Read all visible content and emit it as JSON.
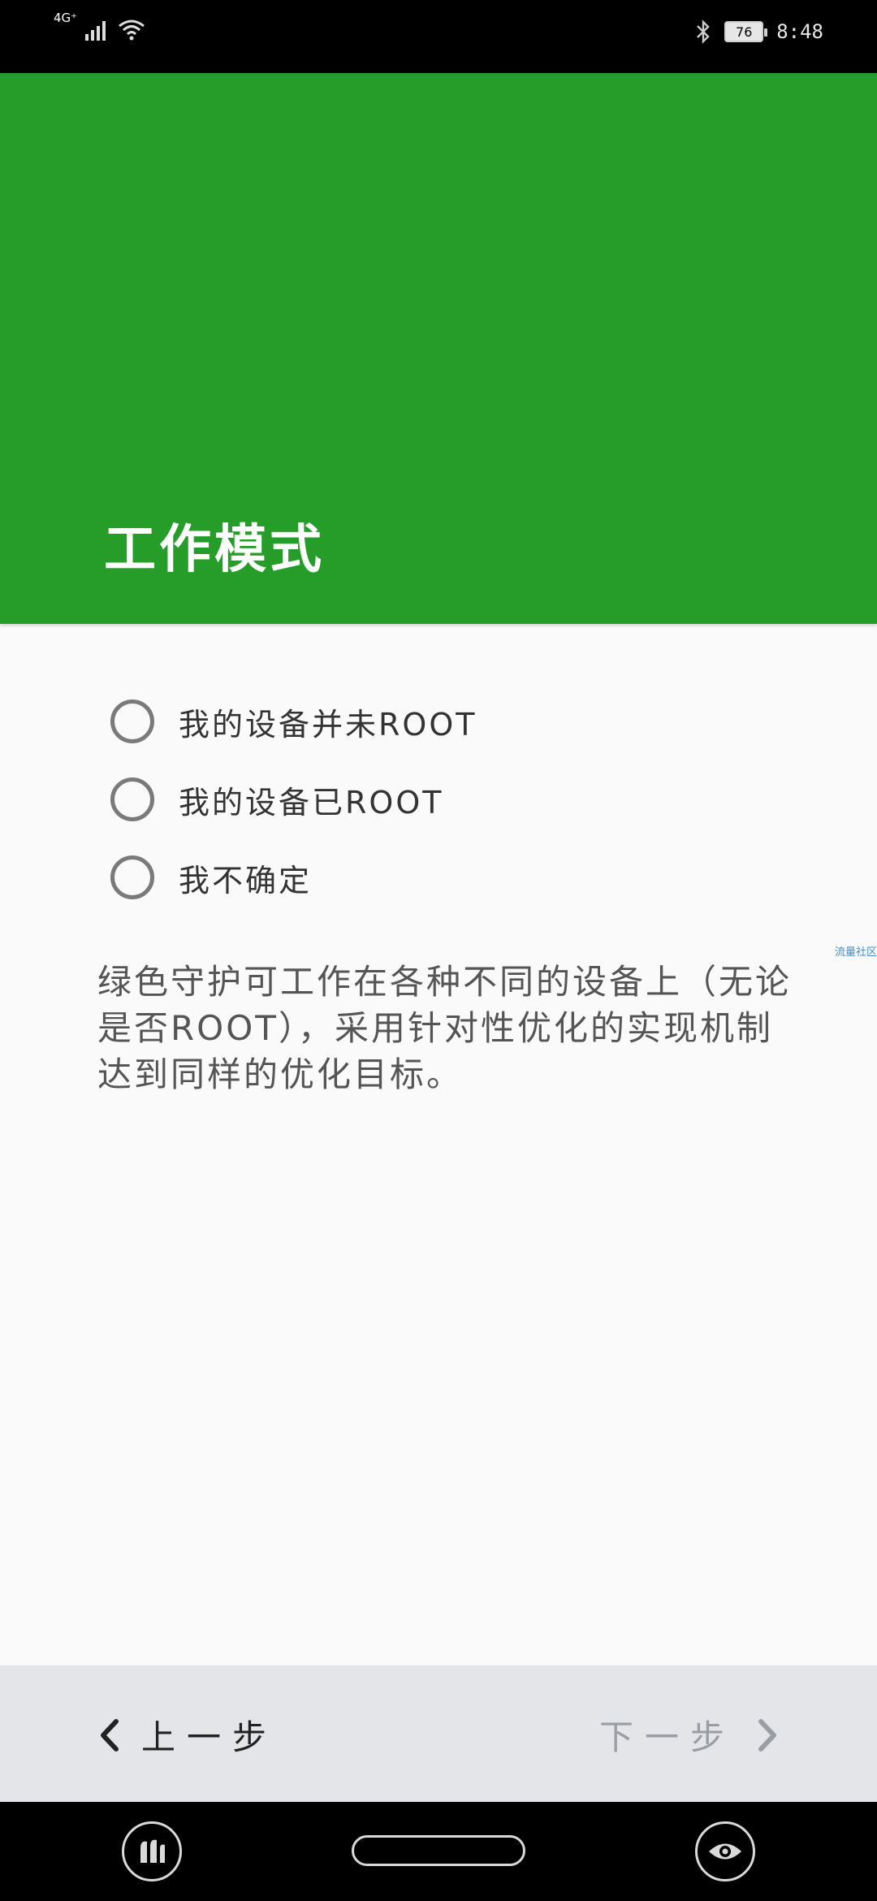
{
  "status_bar": {
    "network_type": "4G⁺",
    "battery_level": "76",
    "time": "8:48",
    "icons": [
      "signal-icon",
      "wifi-icon",
      "bluetooth-icon",
      "battery-icon"
    ]
  },
  "header": {
    "title": "工作模式",
    "background_color": "#259d28"
  },
  "options": [
    {
      "label": "我的设备并未ROOT",
      "selected": false
    },
    {
      "label": "我的设备已ROOT",
      "selected": false
    },
    {
      "label": "我不确定",
      "selected": false
    }
  ],
  "side_tag": "流量社区",
  "description": "绿色守护可工作在各种不同的设备上（无论是否ROOT），采用针对性优化的实现机制达到同样的优化目标。",
  "bottom_nav": {
    "prev_label": "上一步",
    "next_label": "下一步",
    "next_enabled": false
  },
  "system_nav": {
    "icons": [
      "app-icon",
      "home-pill",
      "eye-icon"
    ]
  }
}
